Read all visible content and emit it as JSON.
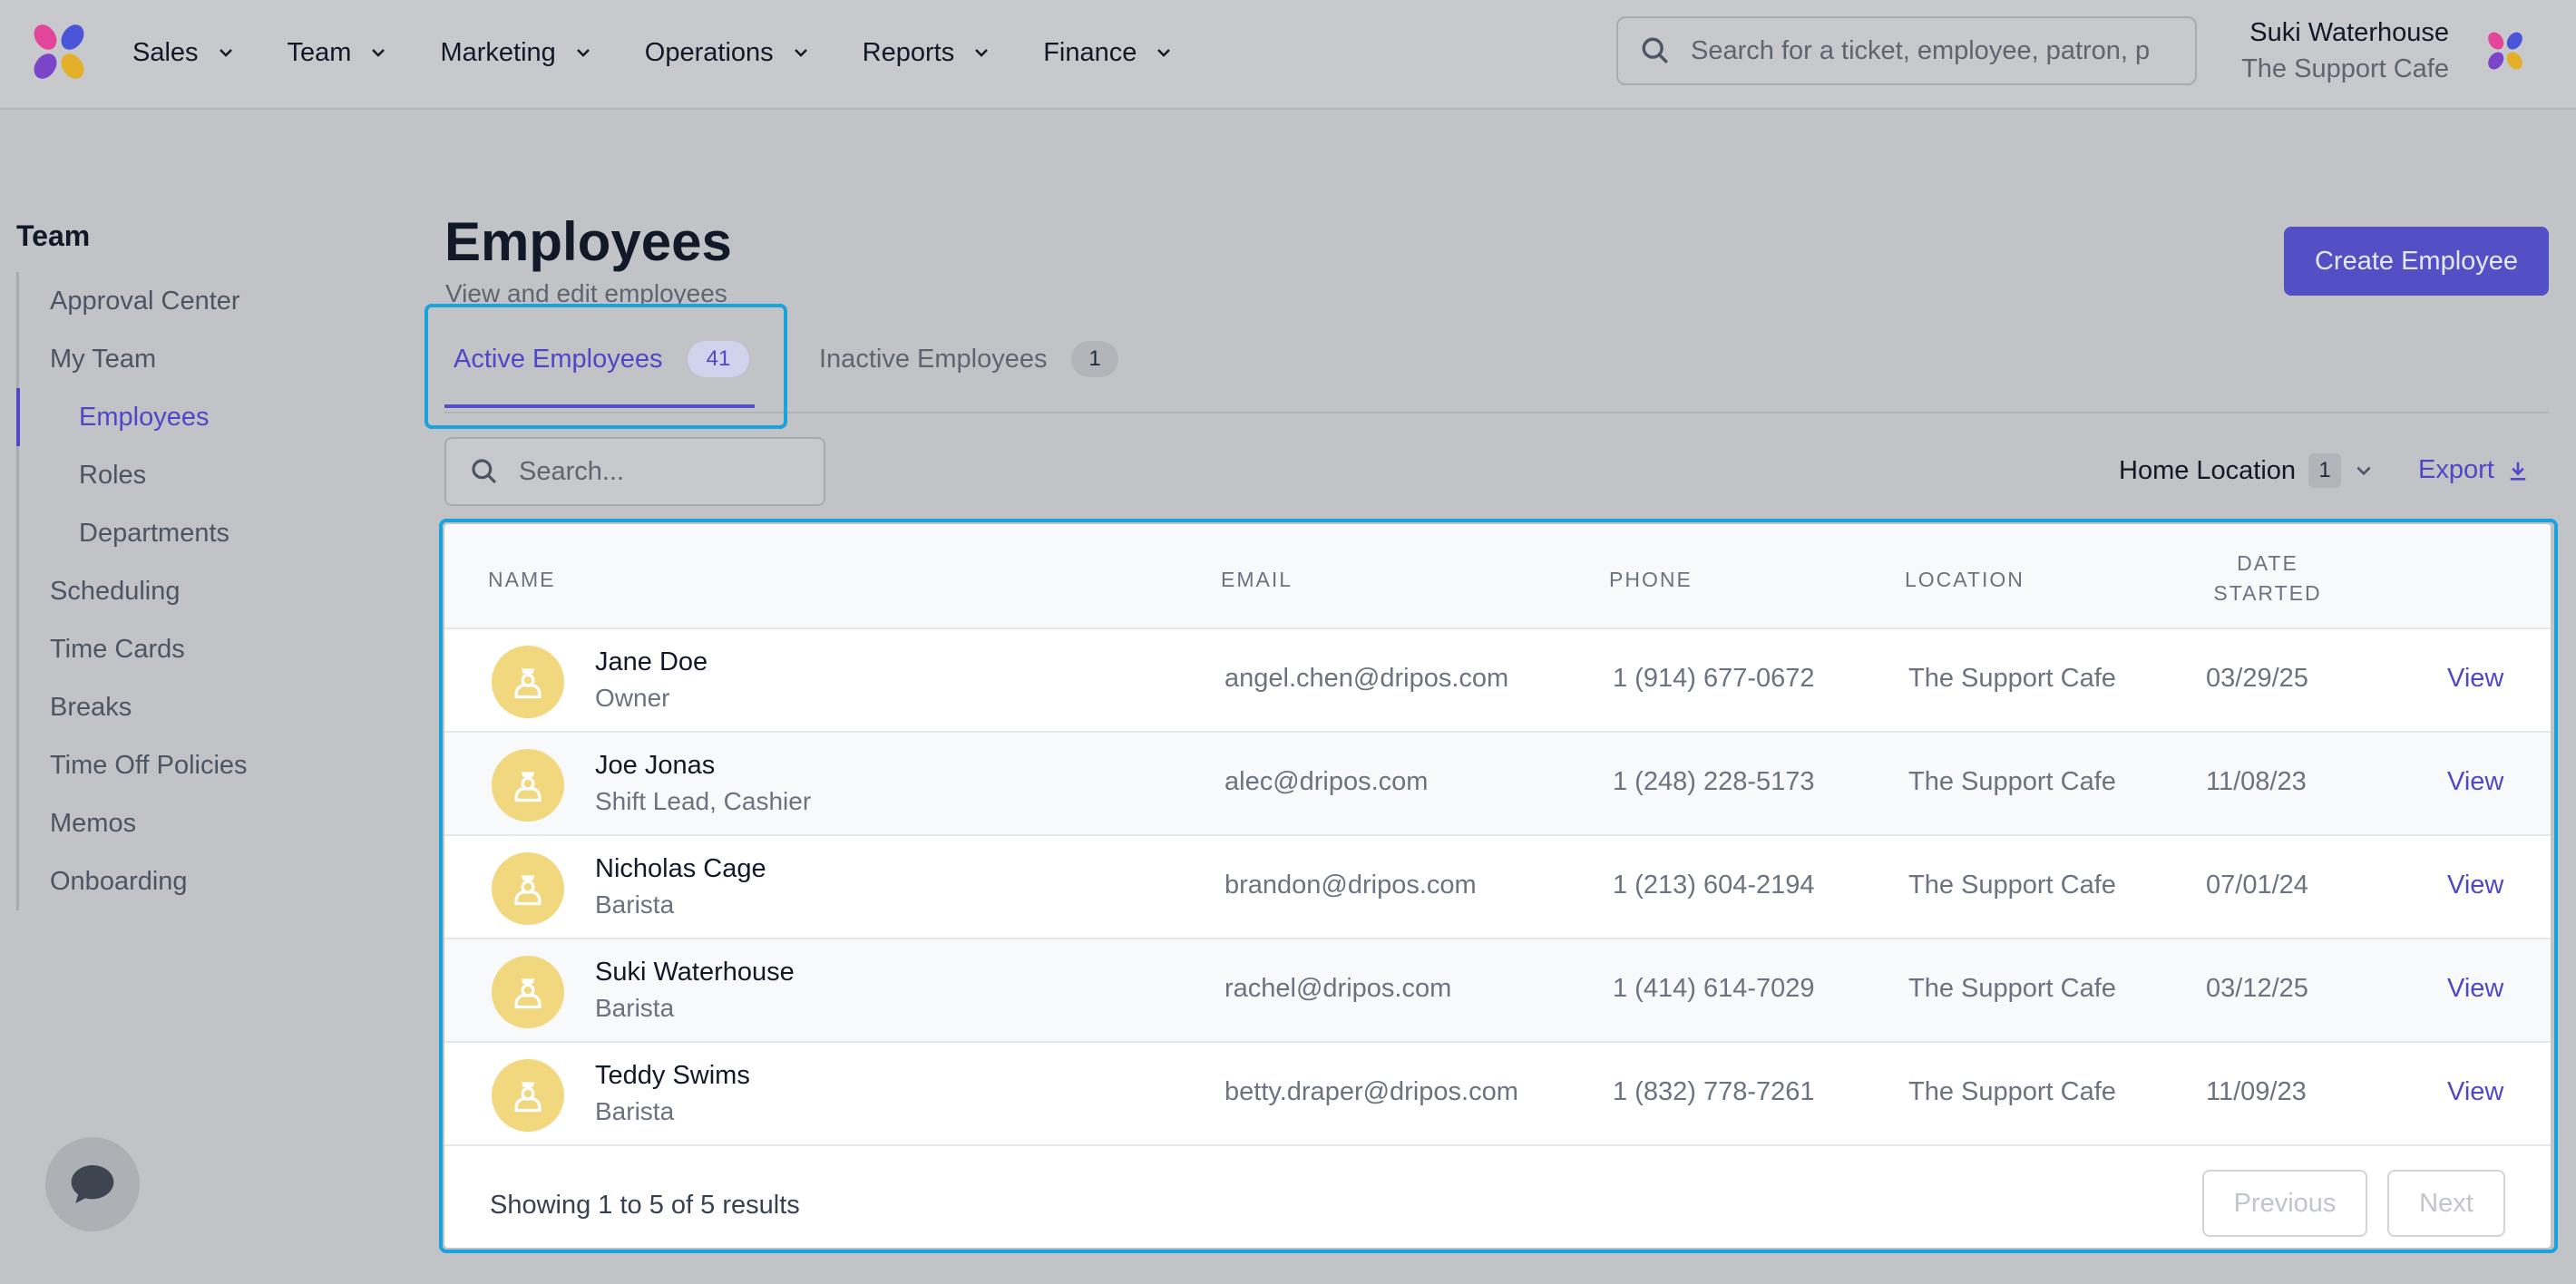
{
  "nav": {
    "items": [
      {
        "label": "Sales"
      },
      {
        "label": "Team"
      },
      {
        "label": "Marketing"
      },
      {
        "label": "Operations"
      },
      {
        "label": "Reports"
      },
      {
        "label": "Finance"
      }
    ],
    "search_placeholder": "Search for a ticket, employee, patron, p",
    "user_name": "Suki Waterhouse",
    "user_org": "The Support Cafe"
  },
  "sidebar": {
    "title": "Team",
    "items": [
      {
        "label": "Approval Center"
      },
      {
        "label": "My Team"
      },
      {
        "label": "Employees"
      },
      {
        "label": "Roles"
      },
      {
        "label": "Departments"
      },
      {
        "label": "Scheduling"
      },
      {
        "label": "Time Cards"
      },
      {
        "label": "Breaks"
      },
      {
        "label": "Time Off Policies"
      },
      {
        "label": "Memos"
      },
      {
        "label": "Onboarding"
      }
    ]
  },
  "header": {
    "title": "Employees",
    "subtitle": "View and edit employees",
    "create_label": "Create Employee"
  },
  "tabs": {
    "active_label": "Active Employees",
    "active_count": "41",
    "inactive_label": "Inactive Employees",
    "inactive_count": "1"
  },
  "filters": {
    "search_placeholder": "Search...",
    "home_location_label": "Home Location",
    "home_location_count": "1",
    "export_label": "Export"
  },
  "table": {
    "headers": {
      "name": "NAME",
      "email": "EMAIL",
      "phone": "PHONE",
      "location": "LOCATION",
      "date_line1": "DATE",
      "date_line2": "STARTED"
    },
    "rows": [
      {
        "name": "Jane Doe",
        "role": "Owner",
        "email": "angel.chen@dripos.com",
        "phone": "1 (914) 677-0672",
        "location": "The Support Cafe",
        "date": "03/29/25",
        "action": "View"
      },
      {
        "name": "Joe Jonas",
        "role": "Shift Lead, Cashier",
        "email": "alec@dripos.com",
        "phone": "1 (248) 228-5173",
        "location": "The Support Cafe",
        "date": "11/08/23",
        "action": "View"
      },
      {
        "name": "Nicholas Cage",
        "role": "Barista",
        "email": "brandon@dripos.com",
        "phone": "1 (213) 604-2194",
        "location": "The Support Cafe",
        "date": "07/01/24",
        "action": "View"
      },
      {
        "name": "Suki Waterhouse",
        "role": "Barista",
        "email": "rachel@dripos.com",
        "phone": "1 (414) 614-7029",
        "location": "The Support Cafe",
        "date": "03/12/25",
        "action": "View"
      },
      {
        "name": "Teddy Swims",
        "role": "Barista",
        "email": "betty.draper@dripos.com",
        "phone": "1 (832) 778-7261",
        "location": "The Support Cafe",
        "date": "11/09/23",
        "action": "View"
      }
    ],
    "footer_text": "Showing 1 to 5 of 5 results",
    "previous_label": "Previous",
    "next_label": "Next"
  },
  "colors": {
    "accent": "#5350c5",
    "highlight": "#1aa3dc",
    "avatar": "#f1d77e"
  },
  "icons": {
    "search": "search-icon",
    "chevron": "chevron-down-icon",
    "export": "download-icon",
    "avatar": "barista-icon",
    "chat": "chat-icon"
  }
}
